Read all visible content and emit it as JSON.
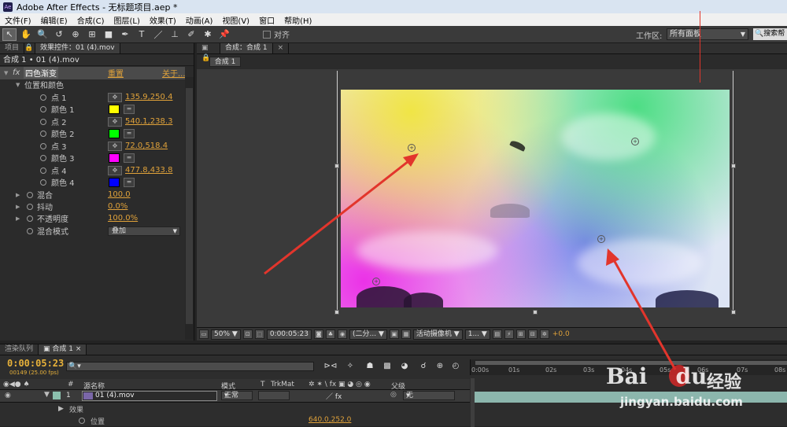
{
  "titlebar": {
    "title": "Adobe After Effects - 无标题项目.aep *",
    "app_icon": "Ae"
  },
  "menu": [
    "文件(F)",
    "编辑(E)",
    "合成(C)",
    "图层(L)",
    "效果(T)",
    "动画(A)",
    "视图(V)",
    "窗口",
    "帮助(H)"
  ],
  "toolbar": {
    "tools": [
      "↖",
      "✋",
      "🔍",
      "↺",
      "⊕",
      "⊞",
      "■",
      "✒",
      "T",
      "／",
      "⊥",
      "✐",
      "✱",
      "📌"
    ],
    "snap_label": "对齐",
    "workspace_label": "工作区:",
    "workspace_value": "所有面板",
    "search_label": "搜索帮"
  },
  "left_panel": {
    "tabs": [
      "项目",
      "效果控件：01 (4).mov"
    ],
    "subtitle": "合成 1 • 01 (4).mov",
    "effect": {
      "fx": "fx",
      "name": "四色渐变",
      "reset": "重置",
      "about": "关于..."
    },
    "group": "位置和颜色",
    "params": [
      {
        "label": "点 1",
        "value": "135.9,250.4",
        "type": "point"
      },
      {
        "label": "颜色 1",
        "color": "#ffff00",
        "type": "color"
      },
      {
        "label": "点 2",
        "value": "540.1,238.3",
        "type": "point"
      },
      {
        "label": "颜色 2",
        "color": "#00ff00",
        "type": "color"
      },
      {
        "label": "点 3",
        "value": "72.0,518.4",
        "type": "point"
      },
      {
        "label": "颜色 3",
        "color": "#ff00ff",
        "type": "color"
      },
      {
        "label": "点 4",
        "value": "477.8,433.8",
        "type": "point"
      },
      {
        "label": "颜色 4",
        "color": "#0000ff",
        "type": "color"
      }
    ],
    "extras": [
      {
        "label": "混合",
        "value": "100.0"
      },
      {
        "label": "抖动",
        "value": "0.0%"
      },
      {
        "label": "不透明度",
        "value": "100.0%"
      }
    ],
    "blend_mode": {
      "label": "混合模式",
      "value": "叠加"
    }
  },
  "comp_panel": {
    "tab": "合成：合成 1",
    "sub_tab": "合成 1"
  },
  "viewer_bar": {
    "zoom": "50%",
    "timecode": "0:00:05:23",
    "resolution": "(二分...",
    "camera": "活动摄像机",
    "views": "1...",
    "exposure": "+0.0"
  },
  "timeline": {
    "tabs": [
      "渲染队列",
      "合成 1"
    ],
    "timecode": "0:00:05:23",
    "fps": "00149 (25.00 fps)",
    "search_placeholder": "",
    "ruler": [
      "0:00s",
      "01s",
      "02s",
      "03s",
      "04s",
      "05s",
      "06s",
      "07s",
      "08s"
    ],
    "columns": {
      "num": "#",
      "source": "源名称",
      "mode": "模式",
      "t": "T",
      "trkmat": "TrkMat",
      "parent": "父级"
    },
    "layer": {
      "num": "1",
      "name": "01 (4).mov",
      "mode": "正常",
      "parent": "无"
    },
    "effects_label": "效果",
    "position": {
      "label": "位置",
      "value": "640.0,252.0"
    }
  },
  "watermark": {
    "brand_latin": "Bai",
    "brand_du": "du",
    "brand_cn": "经验",
    "url": "jingyan.baidu.com"
  },
  "colors": {
    "accent": "#e0a23a",
    "arrow": "#e2352c",
    "timecode": "#e7b13a"
  }
}
